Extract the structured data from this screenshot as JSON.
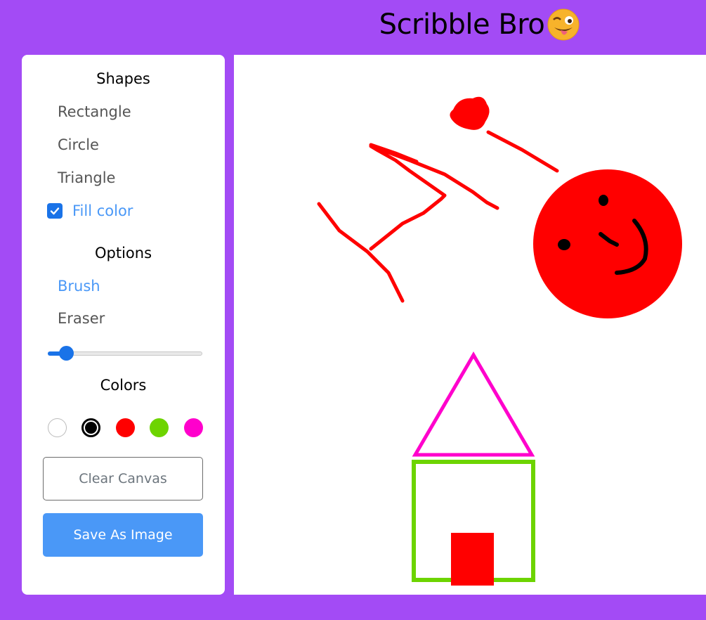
{
  "app": {
    "title": "Scribble Bro",
    "title_emoji": "winking-face-with-tongue-emoji"
  },
  "panel": {
    "shapes_heading": "Shapes",
    "shapes": [
      "Rectangle",
      "Circle",
      "Triangle"
    ],
    "fill_color_label": "Fill color",
    "fill_color_checked": true,
    "options_heading": "Options",
    "options": [
      {
        "label": "Brush",
        "active": true
      },
      {
        "label": "Eraser",
        "active": false
      }
    ],
    "brush_size_fraction": 0.1,
    "colors_heading": "Colors",
    "colors": [
      {
        "hex": "#ffffff",
        "selected": false
      },
      {
        "hex": "#000000",
        "selected": true
      },
      {
        "hex": "#ff0000",
        "selected": false
      },
      {
        "hex": "#6dd400",
        "selected": false
      },
      {
        "hex": "#ff00cc",
        "selected": false
      }
    ],
    "clear_button": "Clear Canvas",
    "save_button": "Save As Image"
  },
  "theme": {
    "background": "#a34bf5",
    "accent": "#4a98f7",
    "control_blue": "#1a73e8"
  }
}
